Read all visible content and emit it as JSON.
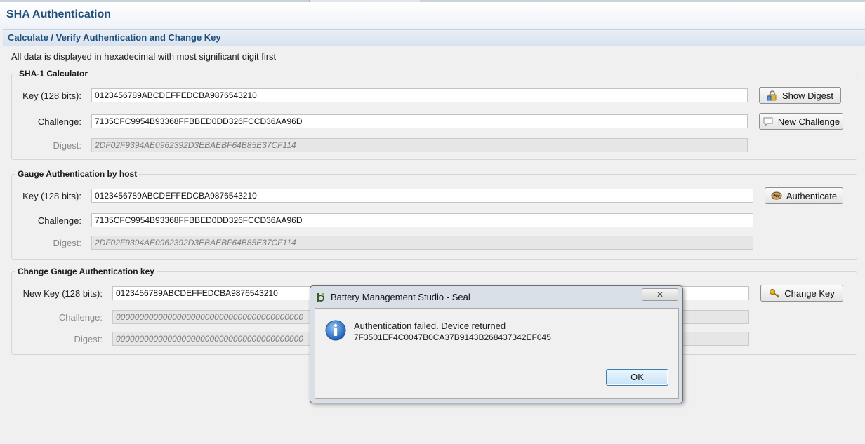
{
  "app": {
    "title": "SHA Authentication",
    "section_title": "Calculate / Verify Authentication and Change Key",
    "info_text": "All data is displayed in hexadecimal with most significant digit first"
  },
  "sha1": {
    "group_title": "SHA-1 Calculator",
    "key_label": "Key (128 bits):",
    "key_value": "0123456789ABCDEFFEDCBA9876543210",
    "challenge_label": "Challenge:",
    "challenge_value": "7135CFC9954B93368FFBBED0DD326FCCD36AA96D",
    "digest_label": "Digest:",
    "digest_value": "2DF02F9394AE0962392D3EBAEBF64B85E37CF114",
    "show_digest_button": "Show Digest",
    "new_challenge_button": "New Challenge"
  },
  "gauge_auth": {
    "group_title": "Gauge Authentication by host",
    "key_label": "Key (128 bits):",
    "key_value": "0123456789ABCDEFFEDCBA9876543210",
    "challenge_label": "Challenge:",
    "challenge_value": "7135CFC9954B93368FFBBED0DD326FCCD36AA96D",
    "digest_label": "Digest:",
    "digest_value": "2DF02F9394AE0962392D3EBAEBF64B85E37CF114",
    "authenticate_button": "Authenticate"
  },
  "change_key": {
    "group_title": "Change Gauge Authentication key",
    "new_key_label": "New Key (128 bits):",
    "new_key_value": "0123456789ABCDEFFEDCBA9876543210",
    "challenge_label": "Challenge:",
    "challenge_value": "0000000000000000000000000000000000000000",
    "digest_label": "Digest:",
    "digest_value": "0000000000000000000000000000000000000000",
    "change_key_button": "Change Key"
  },
  "dialog": {
    "title": "Battery Management Studio - Seal",
    "close_label": "✕",
    "message_line1": "Authentication failed. Device returned",
    "message_line2": "7F3501EF4C0047B0CA37B9143B268437342EF045",
    "ok_button": "OK"
  },
  "icons": {
    "show_digest": "lock-icon",
    "new_challenge": "speech-bubble-icon",
    "authenticate": "handshake-icon",
    "change_key": "key-icon",
    "dialog_logo": "app-logo-icon",
    "dialog_info": "info-icon"
  },
  "colors": {
    "title_blue": "#1f4e7a",
    "info_icon_blue": "#2c6fc4"
  }
}
